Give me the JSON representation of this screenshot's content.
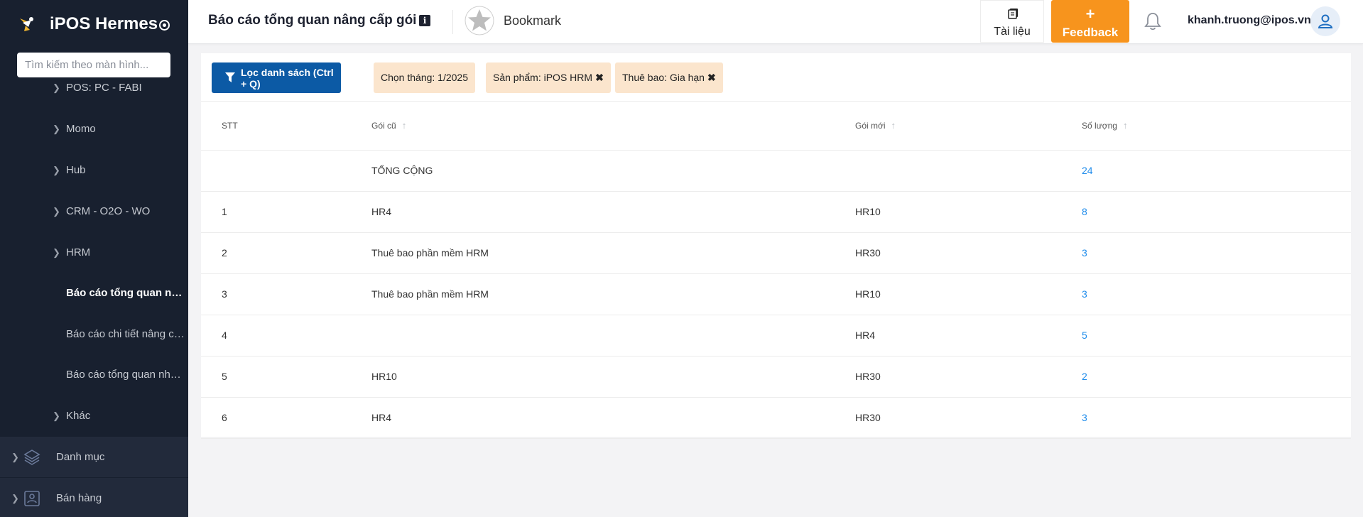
{
  "app": {
    "name": "iPOS Hermes"
  },
  "sidebar": {
    "search_placeholder": "Tìm kiếm theo màn hình...",
    "items": [
      {
        "label": "POS: PC - FABI",
        "type": "sub"
      },
      {
        "label": "Momo",
        "type": "sub"
      },
      {
        "label": "Hub",
        "type": "sub"
      },
      {
        "label": "CRM - O2O - WO",
        "type": "sub"
      },
      {
        "label": "HRM",
        "type": "sub"
      },
      {
        "label": "Báo cáo tổng quan nâng cấp gói",
        "type": "active"
      },
      {
        "label": "Báo cáo chi tiết nâng cấp gói",
        "type": "leaf"
      },
      {
        "label": "Báo cáo tổng quan nhân viên",
        "type": "leaf"
      },
      {
        "label": "Khác",
        "type": "sub"
      },
      {
        "label": "Danh mục",
        "type": "group",
        "icon": "layers-icon"
      },
      {
        "label": "Bán hàng",
        "type": "group",
        "icon": "pos-icon"
      }
    ]
  },
  "header": {
    "title": "Báo cáo tổng quan nâng cấp gói",
    "bookmark_label": "Bookmark",
    "docs_label": "Tài liệu",
    "feedback_plus": "+",
    "feedback_label": "Feedback",
    "user_email": "khanh.truong@ipos.vn"
  },
  "filters": {
    "button_label": "Lọc danh sách (Ctrl + Q)",
    "chips": [
      {
        "label": "Chọn tháng: 1/2025",
        "removable": false
      },
      {
        "label": "Sản phẩm: iPOS HRM",
        "removable": true
      },
      {
        "label": "Thuê bao: Gia hạn",
        "removable": true
      }
    ],
    "remove_glyph": "✖"
  },
  "table": {
    "columns": {
      "stt": "STT",
      "old": "Gói cũ",
      "new": "Gói mới",
      "qty": "Số lượng"
    },
    "total": {
      "label": "TỔNG CỘNG",
      "qty": "24"
    },
    "rows": [
      {
        "stt": "1",
        "old": "HR4",
        "new": "HR10",
        "qty": "8"
      },
      {
        "stt": "2",
        "old": "Thuê bao phần mềm HRM",
        "new": "HR30",
        "qty": "3"
      },
      {
        "stt": "3",
        "old": "Thuê bao phần mềm HRM",
        "new": "HR10",
        "qty": "3"
      },
      {
        "stt": "4",
        "old": "",
        "new": "HR4",
        "qty": "5"
      },
      {
        "stt": "5",
        "old": "HR10",
        "new": "HR30",
        "qty": "2"
      },
      {
        "stt": "6",
        "old": "HR4",
        "new": "HR30",
        "qty": "3"
      }
    ]
  },
  "colors": {
    "sidebar_bg": "#18202f",
    "primary": "#0c5aa5",
    "feedback": "#f7941d",
    "chip_bg": "#fbe5cd",
    "link_number": "#1f8ceb"
  }
}
